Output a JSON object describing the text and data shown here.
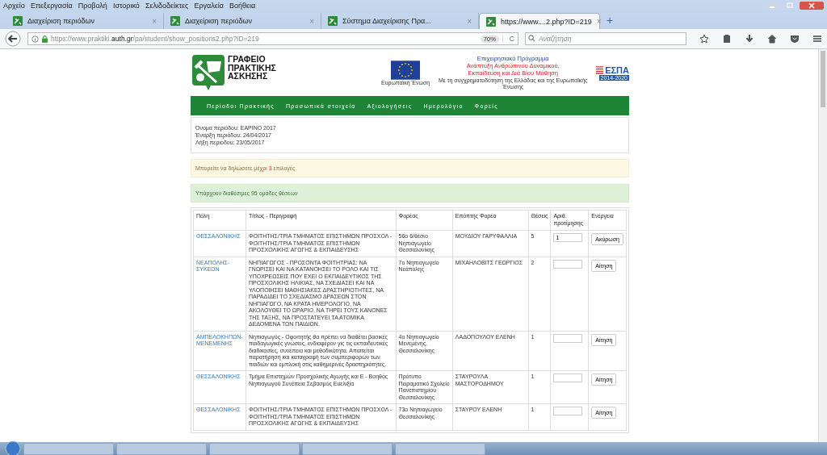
{
  "menu": [
    "Αρχείο",
    "Επεξεργασία",
    "Προβολή",
    "Ιστορικό",
    "Σελιδοδείκτες",
    "Εργαλεία",
    "Βοήθεια"
  ],
  "tab_close": "×",
  "new_tab": "+",
  "reload": "C",
  "tabs": [
    {
      "title": "Διαχείριση περιόδων",
      "selected": false
    },
    {
      "title": "Διαχείριση περιόδων",
      "selected": false
    },
    {
      "title": "Σύστημα Διαχείρισης Πρα...",
      "selected": false
    },
    {
      "title": "https://www....2.php?ID=219",
      "selected": true
    }
  ],
  "address": {
    "pre": "https://www.praktiki.",
    "domain": "auth.gr",
    "post": "/pa/student/show_positions2.php?ID=219",
    "zoom": "70%"
  },
  "search": {
    "placeholder": "Αναζήτηση"
  },
  "logo": [
    "ΓΡΑΦΕΙΟ",
    "ΠΡΑΚΤΙΚΗΣ",
    "ΑΣΚΗΣΗΣ"
  ],
  "sponsors": {
    "eu_caption": "Ευρωπαϊκή Ένωση",
    "program": "Επιχειρησιακό Πρόγραμμα",
    "program_lines": [
      "Ανάπτυξη Ανθρώπινου Δυναμικού,",
      "Εκπαίδευση και Διά Βίου Μάθηση"
    ],
    "cofund": "Με τη συγχρηματοδότηση της Ελλάδας και της Ευρωπαϊκής Ένωσης",
    "espa": "ΕΣΠΑ",
    "espa_years": "2014-2020"
  },
  "nav": [
    "Περίοδοι Πρακτικής",
    "Προσωπικά στοιχεία",
    "Αξιολογήσεις",
    "Ημερολόγιο",
    "Φορείς"
  ],
  "period": [
    "Όνομα περιόδου: ΕΑΡΙΝΟ 2017",
    "Έναρξη περιόδου: 24/04/2017",
    "Λήξη περιόδου: 23/05/2017"
  ],
  "warning": {
    "before": "Μπορείτε να δηλώσετε μέχρι",
    "count": "3",
    "after": "επιλογές"
  },
  "success": "Υπάρχουν διαθέσιμες 95 ομάδες θέσεων",
  "table": {
    "columns": [
      "Πόλη",
      "Τίτλος - Περιγραφή",
      "Φορέας",
      "Επόπτης Φορέα",
      "Θέσεις",
      "Αριθ. προτίμησης",
      "Ενέργεια"
    ],
    "rows": [
      {
        "city": "ΘΕΣΣΑΛΟΝΙΚΗΣ",
        "title": "ΦΟΙΤΗΤΗΣ/ΤΡΙΑ ΤΜΗΜΑΤΟΣ ΕΠΙΣΤΗΜΩΝ ΠΡΟΣΧΟΛ - ΦΟΙΤΗΤΗΣ/ΤΡΙΑ ΤΜΗΜΑΤΟΣ ΕΠΙΣΤΗΜΩΝ ΠΡΟΣΧΟΛΙΚΗΣ ΑΓΩΓΗΣ & ΕΚΠΑΙΔΕΥΣΗΣ",
        "org": "56ο 6/θέσιο Νηπιαγωγείο Θεσσαλονίκης",
        "supervisor": "ΜΟΥΔΙΟΥ ΓΑΡΥΦΑΛΛΙΑ",
        "positions": "5",
        "preference": "1",
        "action": "Ακύρωση"
      },
      {
        "city": "ΝΕΑΠΟΛΗΣ-ΣΥΚΕΩΝ",
        "title": "ΝΗΠΙΑΓΩΓΟΣ - ΠΡΟΣΟΝΤΑ ΦΟΙΤΗΤΡΙΑΣ: ΝΑ ΓΝΩΡΙΣΕΙ ΚΑΙ ΝΑ ΚΑΤΑΝΟΗΣΕΙ ΤΟ ΡΟΛΟ ΚΑΙ ΤΙΣ ΥΠΟΧΡΕΩΣΕΙΣ ΠΟΥ ΕΧΕΙ Ο ΕΚΠΑΙΔΕΥΤΙΚΟΣ ΤΗΣ ΠΡΟΣΧΟΛΙΚΗΣ ΗΛΙΚΙΑΣ, ΝΑ ΣΧΕΔΙΑΣΕΙ ΚΑΙ ΝΑ ΥΛΟΠΟΙΗΣΕΙ ΜΑΘΗΣΙΑΚΕΣ ΔΡΑΣΤΗΡΙΟΤΗΤΕΣ, ΝΑ ΠΑΡΑΔΙΔΕΙ ΤΟ ΣΧΕΔΙΑΣΜΟ ΔΡΑΣΕΩΝ ΣΤΟΝ ΝΗΠΙΑΓΩΓΟ, ΝΑ ΚΡΑΤΑ ΗΜΕΡΟΛΟΓΙΟ, ΝΑ ΑΚΟΛΟΥΘΕΙ ΤΟ ΩΡΑΡΙΟ, ΝΑ ΤΗΡΕΙ ΤΟΥΣ ΚΑΝΟΝΕΣ ΤΗΣ ΤΑΞΗΣ, ΝΑ ΠΡΟΣΤΑΤΕΥΕΙ ΤΑ ΑΤΟΜΙΚΑ ΔΕΔΟΜΕΝΑ ΤΩΝ ΠΑΙΔΙΩΝ.",
        "org": "7ο Νηπιαγωγείο Νεάπολης",
        "supervisor": "ΜΙΧΑΗΛΟΒΙΤΣ ΓΕΩΡΓΙΟΣ",
        "positions": "2",
        "action": "Αίτηση"
      },
      {
        "city": "ΑΜΠΕΛΟΚΗΠΩΝ-ΜΕΝΕΜΕΝΗΣ",
        "title": "Νηπιαγωγός - Οφοιτητής θα πρέπει να διαθέτει βασικές παιδαγωγικές γνώσεις, ενδιαφέρον γις τις εκπαιδευτικές διαδικασίες, συνέπεια και μεθοδικότητα. Απαιτείται παρατήρηση και καταγραφή των συμπεριφορών των παιδιών και εμπλοκή στις καθημερινές δραστηριότητες.",
        "org": "4ο Νηπιαγωγείο Μενεμένης, Θεσσαλονίκης",
        "supervisor": "ΛΑΔΟΠΟΥΛΟΥ ΕΛΕΝΗ",
        "positions": "1",
        "action": "Αίτηση"
      },
      {
        "city": "ΘΕΣΣΑΛΟΝΙΚΗΣ",
        "title": "Τμήμα Επιστημών Προσχολικής Αγωγής και Ε - Βοηθός Νηπιαγωγού Συνέπεια Σεβασμός Ευελιξία",
        "org": "Πρότυπο Πειραματικό Σχολείο Πανεπιστημίου Θεσσαλονίκης",
        "supervisor": "ΣΤΑΥΡΟΥΛΑ ΜΑΣΤΟΡΟΔΗΜΟΥ",
        "positions": "1",
        "action": "Αίτηση"
      },
      {
        "city": "ΘΕΣΣΑΛΟΝΙΚΗΣ",
        "title": "ΦΟΙΤΗΤΗΣ/ΤΡΙΑ ΤΜΗΜΑΤΟΣ ΕΠΙΣΤΗΜΩΝ ΠΡΟΣΧΟΛ - ΦΟΙΤΗΤΗΣ/ΤΡΙΑ ΤΜΗΜΑΤΟΣ ΕΠΙΣΤΗΜΩΝ ΠΡΟΣΧΟΛΙΚΗΣ ΑΓΩΓΗΣ & ΕΚΠΑΙΔΕΥΣΗΣ",
        "org": "73ο Νηπιαγωγείο Θεσσαλονίκης",
        "supervisor": "ΣΤΑΥΡΟΥ ΕΛΕΝΗ",
        "positions": "1",
        "action": "Αίτηση"
      }
    ]
  }
}
